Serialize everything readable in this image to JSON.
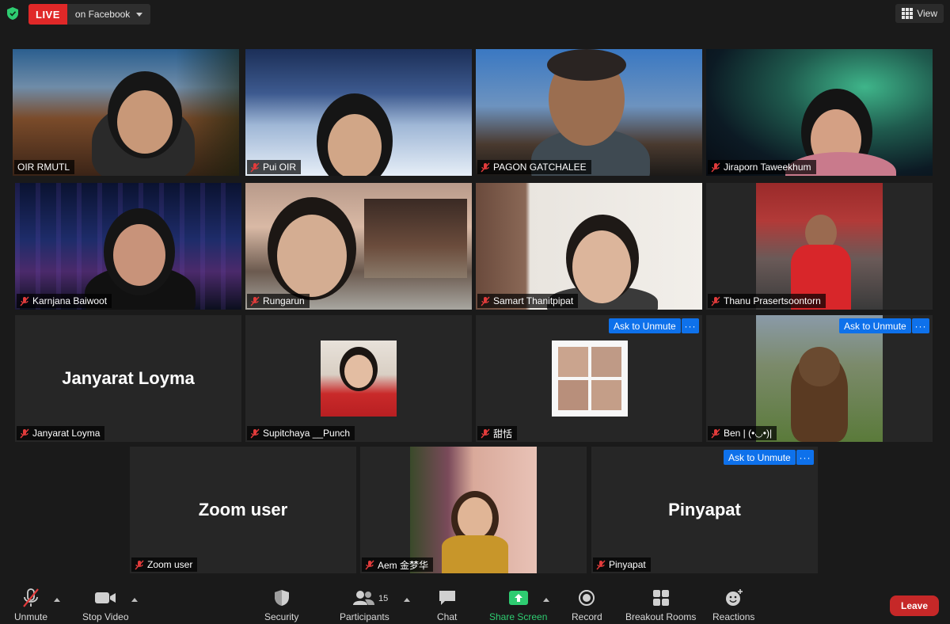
{
  "live": {
    "badge": "LIVE",
    "destination": "on Facebook"
  },
  "view_label": "View",
  "tiles": [
    {
      "name": "OIR RMUTL",
      "muted": false
    },
    {
      "name": "Pui OIR",
      "muted": true
    },
    {
      "name": "PAGON GATCHALEE",
      "muted": true
    },
    {
      "name": "Jiraporn Taweekhum",
      "muted": true
    },
    {
      "name": "Karnjana Baiwoot",
      "muted": true
    },
    {
      "name": "Rungarun",
      "muted": true
    },
    {
      "name": "Samart Thanitpipat",
      "muted": true
    },
    {
      "name": "Thanu Prasertsoontorn",
      "muted": true
    },
    {
      "name": "Janyarat Loyma",
      "muted": true,
      "big_label": "Janyarat Loyma"
    },
    {
      "name": "Supitchaya __Punch",
      "muted": true
    },
    {
      "name": "甜恬",
      "muted": true
    },
    {
      "name": "Ben | (•◡•)|",
      "muted": true
    },
    {
      "name": "Zoom user",
      "muted": true,
      "big_label": "Zoom user"
    },
    {
      "name": "Aem 金梦华",
      "muted": true
    },
    {
      "name": "Pinyapat",
      "muted": true,
      "big_label": "Pinyapat"
    }
  ],
  "ask_unmute_label": "Ask to Unmute",
  "more_label": "···",
  "toolbar": {
    "unmute": "Unmute",
    "stop_video": "Stop Video",
    "security": "Security",
    "participants": "Participants",
    "participants_count": "15",
    "chat": "Chat",
    "share_screen": "Share Screen",
    "record": "Record",
    "breakout_rooms": "Breakout Rooms",
    "reactions": "Reactions",
    "leave": "Leave"
  },
  "colors": {
    "active_speaker": "#c8e16a",
    "live_red": "#e02828",
    "zoom_blue": "#0e71eb",
    "share_green": "#2ecc71",
    "leave_red": "#c62828"
  }
}
